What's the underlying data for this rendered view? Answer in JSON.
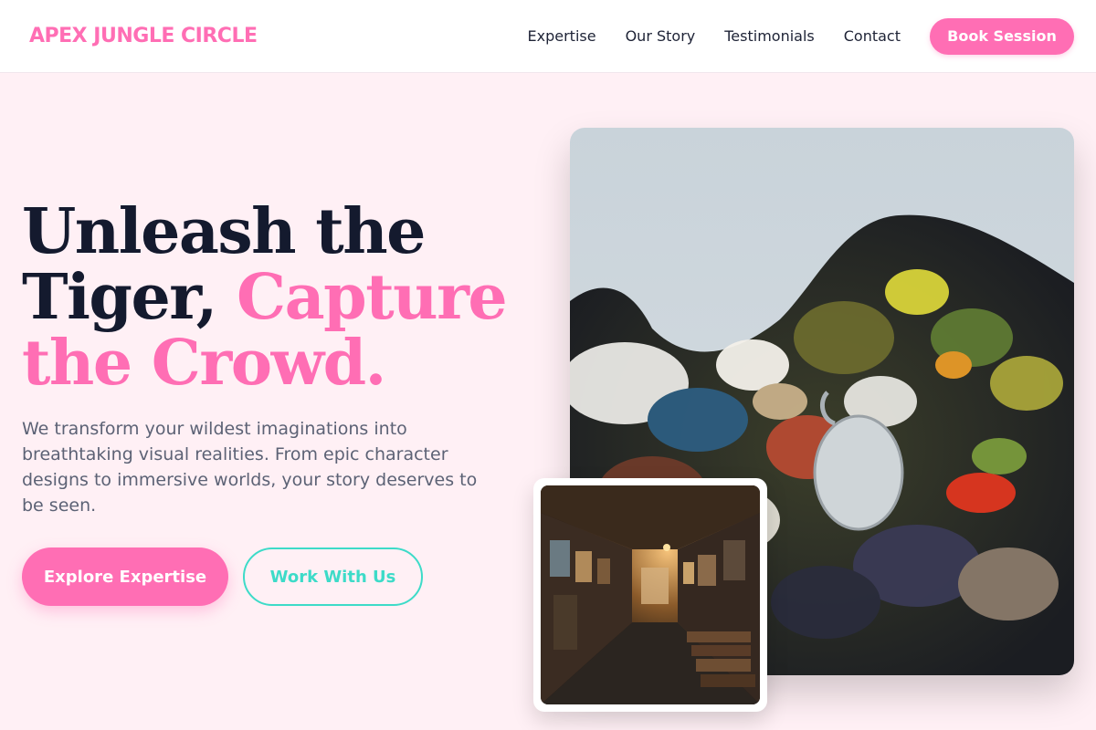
{
  "header": {
    "logo": "APEX JUNGLE CIRCLE",
    "nav": [
      "Expertise",
      "Our Story",
      "Testimonials",
      "Contact"
    ],
    "cta": "Book Session"
  },
  "hero": {
    "title_line1": "Unleash the",
    "title_line2_plain": "Tiger, ",
    "title_line2_accent": "Capture",
    "title_line3_accent": "the Crowd.",
    "description": "We transform your wildest imaginations into breathtaking visual realities. From epic character designs to immersive worlds, your story deserves to be seen.",
    "primary_button": "Explore Expertise",
    "secondary_button": "Work With Us"
  },
  "images": {
    "main": "paint-palette-photo",
    "inset": "art-gallery-corridor-photo"
  },
  "colors": {
    "accent": "#ff6eb4",
    "teal": "#3ddbc8",
    "dark": "#141a2e",
    "background": "#fff0f5"
  }
}
